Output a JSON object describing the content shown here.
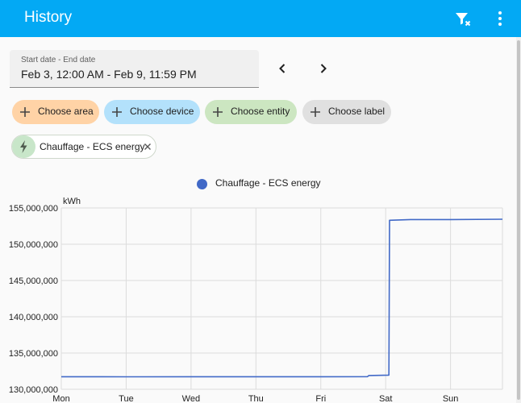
{
  "appbar": {
    "title": "History",
    "filter_icon": "filter-remove-icon",
    "menu_icon": "dots-vertical-icon"
  },
  "date_range": {
    "label": "Start date - End date",
    "value": "Feb 3, 12:00 AM - Feb 9, 11:59 PM"
  },
  "pickers": [
    {
      "label": "Choose area",
      "color": "#ffd3a6"
    },
    {
      "label": "Choose device",
      "color": "#b3e1fb"
    },
    {
      "label": "Choose entity",
      "color": "#cce6c1"
    },
    {
      "label": "Choose label",
      "color": "#e0e0e0"
    }
  ],
  "selected_entity": {
    "label": "Chauffage - ECS energy",
    "icon": "lightning-bolt-icon"
  },
  "chart_data": {
    "type": "line",
    "legend": [
      {
        "name": "Chauffage - ECS energy",
        "color": "#4169c7"
      }
    ],
    "y_unit": "kWh",
    "ylim": [
      130000000,
      155000000
    ],
    "y_ticks": [
      "155,000,000",
      "150,000,000",
      "145,000,000",
      "140,000,000",
      "135,000,000",
      "130,000,000"
    ],
    "x_ticks": [
      "Mon",
      "Tue",
      "Wed",
      "Thu",
      "Fri",
      "Sat",
      "Sun"
    ],
    "xlim": [
      0,
      6.8
    ],
    "grid": true,
    "series": [
      {
        "name": "Chauffage - ECS energy",
        "color": "#4169c7",
        "points": [
          [
            0,
            131730000
          ],
          [
            1.0,
            131720000
          ],
          [
            2.0,
            131730000
          ],
          [
            3.0,
            131730000
          ],
          [
            4.0,
            131730000
          ],
          [
            4.72,
            131740000
          ],
          [
            4.74,
            131900000
          ],
          [
            5.05,
            131950000
          ],
          [
            5.06,
            153300000
          ],
          [
            5.4,
            153400000
          ],
          [
            6.0,
            153400000
          ],
          [
            6.8,
            153450000
          ]
        ]
      }
    ]
  }
}
